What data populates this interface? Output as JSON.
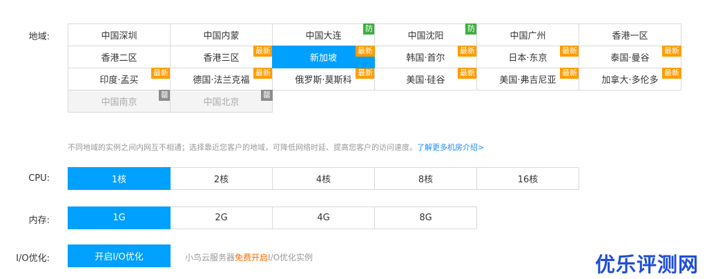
{
  "region": {
    "label": "地域:",
    "options": [
      {
        "name": "中国深圳",
        "badge": "",
        "state": "normal"
      },
      {
        "name": "中国内蒙",
        "badge": "",
        "state": "normal"
      },
      {
        "name": "中国大连",
        "badge": "防",
        "state": "normal"
      },
      {
        "name": "中国沈阳",
        "badge": "防",
        "state": "normal"
      },
      {
        "name": "中国广州",
        "badge": "",
        "state": "normal"
      },
      {
        "name": "香港一区",
        "badge": "",
        "state": "normal"
      },
      {
        "name": "香港二区",
        "badge": "",
        "state": "normal"
      },
      {
        "name": "香港三区",
        "badge": "最新",
        "state": "normal"
      },
      {
        "name": "新加坡",
        "badge": "最新",
        "state": "selected"
      },
      {
        "name": "韩国·首尔",
        "badge": "最新",
        "state": "normal"
      },
      {
        "name": "日本·东京",
        "badge": "最新",
        "state": "normal"
      },
      {
        "name": "泰国·曼谷",
        "badge": "最新",
        "state": "normal"
      },
      {
        "name": "印度·孟买",
        "badge": "最新",
        "state": "normal"
      },
      {
        "name": "德国·法兰克福",
        "badge": "最新",
        "state": "normal"
      },
      {
        "name": "俄罗斯·莫斯科",
        "badge": "最新",
        "state": "normal"
      },
      {
        "name": "美国·硅谷",
        "badge": "最新",
        "state": "normal"
      },
      {
        "name": "美国·弗吉尼亚",
        "badge": "最新",
        "state": "normal"
      },
      {
        "name": "加拿大·多伦多",
        "badge": "最新",
        "state": "normal"
      },
      {
        "name": "中国南京",
        "badge": "罄",
        "state": "disabled"
      },
      {
        "name": "中国北京",
        "badge": "罄",
        "state": "disabled"
      }
    ],
    "hint_text": "不同地域的实例之间内网互不相通；选择靠近您客户的地域，可降低网络时延、提高您客户的访问速度。",
    "hint_link": "了解更多机房介绍>"
  },
  "cpu": {
    "label": "CPU:",
    "options": [
      {
        "name": "1核",
        "state": "selected"
      },
      {
        "name": "2核",
        "state": "normal"
      },
      {
        "name": "4核",
        "state": "normal"
      },
      {
        "name": "8核",
        "state": "normal"
      },
      {
        "name": "16核",
        "state": "normal"
      }
    ]
  },
  "memory": {
    "label": "内存:",
    "options": [
      {
        "name": "1G",
        "state": "selected"
      },
      {
        "name": "2G",
        "state": "normal"
      },
      {
        "name": "4G",
        "state": "normal"
      },
      {
        "name": "8G",
        "state": "normal"
      }
    ]
  },
  "io": {
    "label": "I/O优化:",
    "option": "开启I/O优化",
    "note_prefix": "小鸟云服务器",
    "note_highlight": "免费开启",
    "note_suffix": "I/O优化实例"
  },
  "watermark": "优乐评测网",
  "colors": {
    "accent": "#00a0ff",
    "badge_new": "#ff9c00",
    "badge_defense": "#3cae3c",
    "badge_soldout": "#8c8c8c",
    "link": "#1a8cff",
    "highlight": "#ff6a00"
  }
}
